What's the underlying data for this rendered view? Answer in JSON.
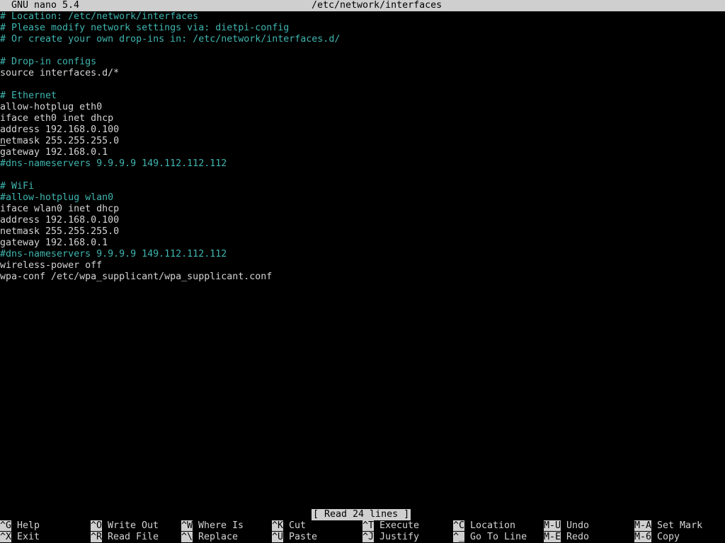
{
  "titlebar": {
    "app": "GNU nano 5.4",
    "filename": "/etc/network/interfaces"
  },
  "editor": {
    "lines": [
      {
        "text": "# Location: /etc/network/interfaces",
        "kind": "comment"
      },
      {
        "text": "# Please modify network settings via: dietpi-config",
        "kind": "comment"
      },
      {
        "text": "# Or create your own drop-ins in: /etc/network/interfaces.d/",
        "kind": "comment"
      },
      {
        "text": "",
        "kind": "plain"
      },
      {
        "text": "# Drop-in configs",
        "kind": "comment"
      },
      {
        "text": "source interfaces.d/*",
        "kind": "plain"
      },
      {
        "text": "",
        "kind": "plain"
      },
      {
        "text": "# Ethernet",
        "kind": "comment"
      },
      {
        "text": "allow-hotplug eth0",
        "kind": "plain"
      },
      {
        "text": "iface eth0 inet dhcp",
        "kind": "plain"
      },
      {
        "text": "address 192.168.0.100",
        "kind": "plain"
      },
      {
        "text": "netmask 255.255.255.0",
        "kind": "plain",
        "cursor": true
      },
      {
        "text": "gateway 192.168.0.1",
        "kind": "plain"
      },
      {
        "text": "#dns-nameservers 9.9.9.9 149.112.112.112",
        "kind": "comment"
      },
      {
        "text": "",
        "kind": "plain"
      },
      {
        "text": "# WiFi",
        "kind": "comment"
      },
      {
        "text": "#allow-hotplug wlan0",
        "kind": "comment"
      },
      {
        "text": "iface wlan0 inet dhcp",
        "kind": "plain"
      },
      {
        "text": "address 192.168.0.100",
        "kind": "plain"
      },
      {
        "text": "netmask 255.255.255.0",
        "kind": "plain"
      },
      {
        "text": "gateway 192.168.0.1",
        "kind": "plain"
      },
      {
        "text": "#dns-nameservers 9.9.9.9 149.112.112.112",
        "kind": "comment"
      },
      {
        "text": "wireless-power off",
        "kind": "plain"
      },
      {
        "text": "wpa-conf /etc/wpa_supplicant/wpa_supplicant.conf",
        "kind": "plain"
      }
    ]
  },
  "status": {
    "message": "[ Read 24 lines ]"
  },
  "shortcuts": {
    "row1": [
      {
        "key": "^G",
        "label": "Help"
      },
      {
        "key": "^O",
        "label": "Write Out"
      },
      {
        "key": "^W",
        "label": "Where Is"
      },
      {
        "key": "^K",
        "label": "Cut"
      },
      {
        "key": "^T",
        "label": "Execute"
      },
      {
        "key": "^C",
        "label": "Location"
      },
      {
        "key": "M-U",
        "label": "Undo"
      },
      {
        "key": "M-A",
        "label": "Set Mark"
      }
    ],
    "row2": [
      {
        "key": "^X",
        "label": "Exit"
      },
      {
        "key": "^R",
        "label": "Read File"
      },
      {
        "key": "^\\",
        "label": "Replace"
      },
      {
        "key": "^U",
        "label": "Paste"
      },
      {
        "key": "^J",
        "label": "Justify"
      },
      {
        "key": "^_",
        "label": "Go To Line"
      },
      {
        "key": "M-E",
        "label": "Redo"
      },
      {
        "key": "M-6",
        "label": "Copy"
      }
    ]
  },
  "colors": {
    "background": "#000000",
    "text": "#d4d4d4",
    "comment": "#3fb6b0",
    "bar": "#cfcfcf"
  }
}
